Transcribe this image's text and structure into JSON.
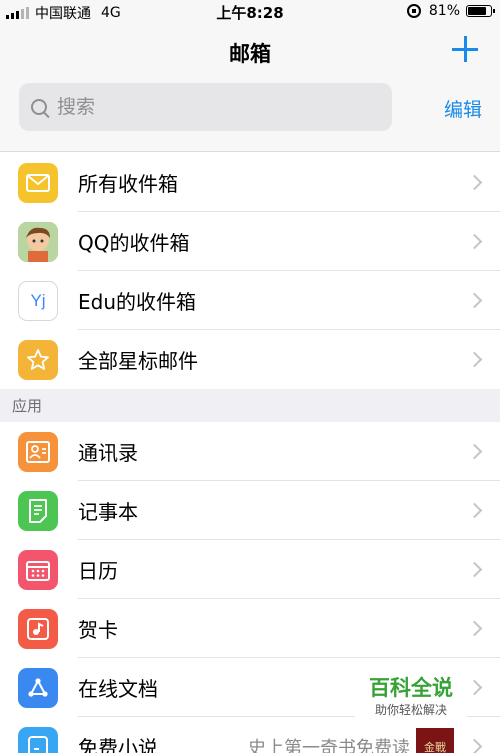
{
  "status_bar": {
    "carrier": "中国联通",
    "network": "4G",
    "time": "上午8:28",
    "battery": "81%",
    "battery_level": 0.81
  },
  "nav": {
    "title": "邮箱",
    "edit_label": "编辑",
    "add_icon": "plus-icon"
  },
  "search": {
    "placeholder": "搜索"
  },
  "mailboxes": [
    {
      "label": "所有收件箱",
      "icon": "envelope-icon",
      "color": "#f5c42c"
    },
    {
      "label": "QQ的收件箱",
      "icon": "avatar-icon",
      "color": "#caa37a"
    },
    {
      "label": "Edu的收件箱",
      "icon": "yj-icon",
      "icon_text": "Yj",
      "color": "#ffffff"
    },
    {
      "label": "全部星标邮件",
      "icon": "star-icon",
      "color": "#f3b437"
    }
  ],
  "section_apps": "应用",
  "apps": [
    {
      "label": "通讯录",
      "icon": "contacts-icon",
      "color": "#f5923a"
    },
    {
      "label": "记事本",
      "icon": "notepad-icon",
      "color": "#4cc552"
    },
    {
      "label": "日历",
      "icon": "calendar-icon",
      "color": "#f3566c"
    },
    {
      "label": "贺卡",
      "icon": "card-icon",
      "color": "#f35b47"
    },
    {
      "label": "在线文档",
      "icon": "share-icon",
      "color": "#3a89f0"
    },
    {
      "label": "免费小说",
      "icon": "book-icon",
      "color": "#39a6f4",
      "promo": "史上第一奇书免费读",
      "thumb_text": "金戰"
    }
  ],
  "watermark": {
    "title": "百科全说",
    "subtitle": "助你轻松解决"
  }
}
